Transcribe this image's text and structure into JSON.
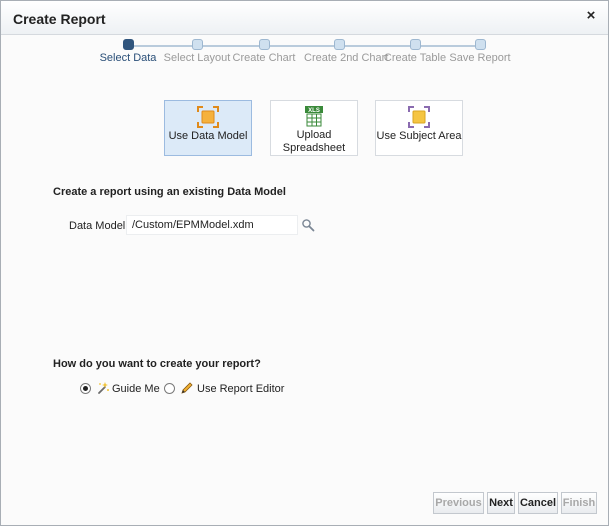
{
  "dialog": {
    "title": "Create Report",
    "close_glyph": "×"
  },
  "train": {
    "steps": [
      {
        "label": "Select Data",
        "active": true
      },
      {
        "label": "Select Layout",
        "active": false
      },
      {
        "label": "Create Chart",
        "active": false
      },
      {
        "label": "Create 2nd Chart",
        "active": false
      },
      {
        "label": "Create Table",
        "active": false
      },
      {
        "label": "Save Report",
        "active": false
      }
    ]
  },
  "sources": [
    {
      "label": "Use Data Model",
      "selected": true,
      "icon": "data-model-icon"
    },
    {
      "label": "Upload Spreadsheet",
      "selected": false,
      "icon": "xls-spreadsheet-icon",
      "badge": "XLS"
    },
    {
      "label": "Use Subject Area",
      "selected": false,
      "icon": "subject-area-icon"
    }
  ],
  "data_model": {
    "heading": "Create a report using an existing Data Model",
    "label": "Data Model",
    "value": "/Custom/EPMModel.xdm"
  },
  "create_mode": {
    "heading": "How do you want to create your report?",
    "options": [
      {
        "label": "Guide Me",
        "selected": true,
        "icon": "magic-wand-icon"
      },
      {
        "label": "Use Report Editor",
        "selected": false,
        "icon": "pencil-icon"
      }
    ]
  },
  "buttons": {
    "previous": "Previous",
    "next": "Next",
    "cancel": "Cancel",
    "finish": "Finish"
  },
  "colors": {
    "active_step": "#30557d",
    "selected_tile": "#dceaf8",
    "data_model_icon": "#f0a030",
    "xls_green": "#3a8a3a",
    "subject_area_purple": "#8a6bb0"
  }
}
